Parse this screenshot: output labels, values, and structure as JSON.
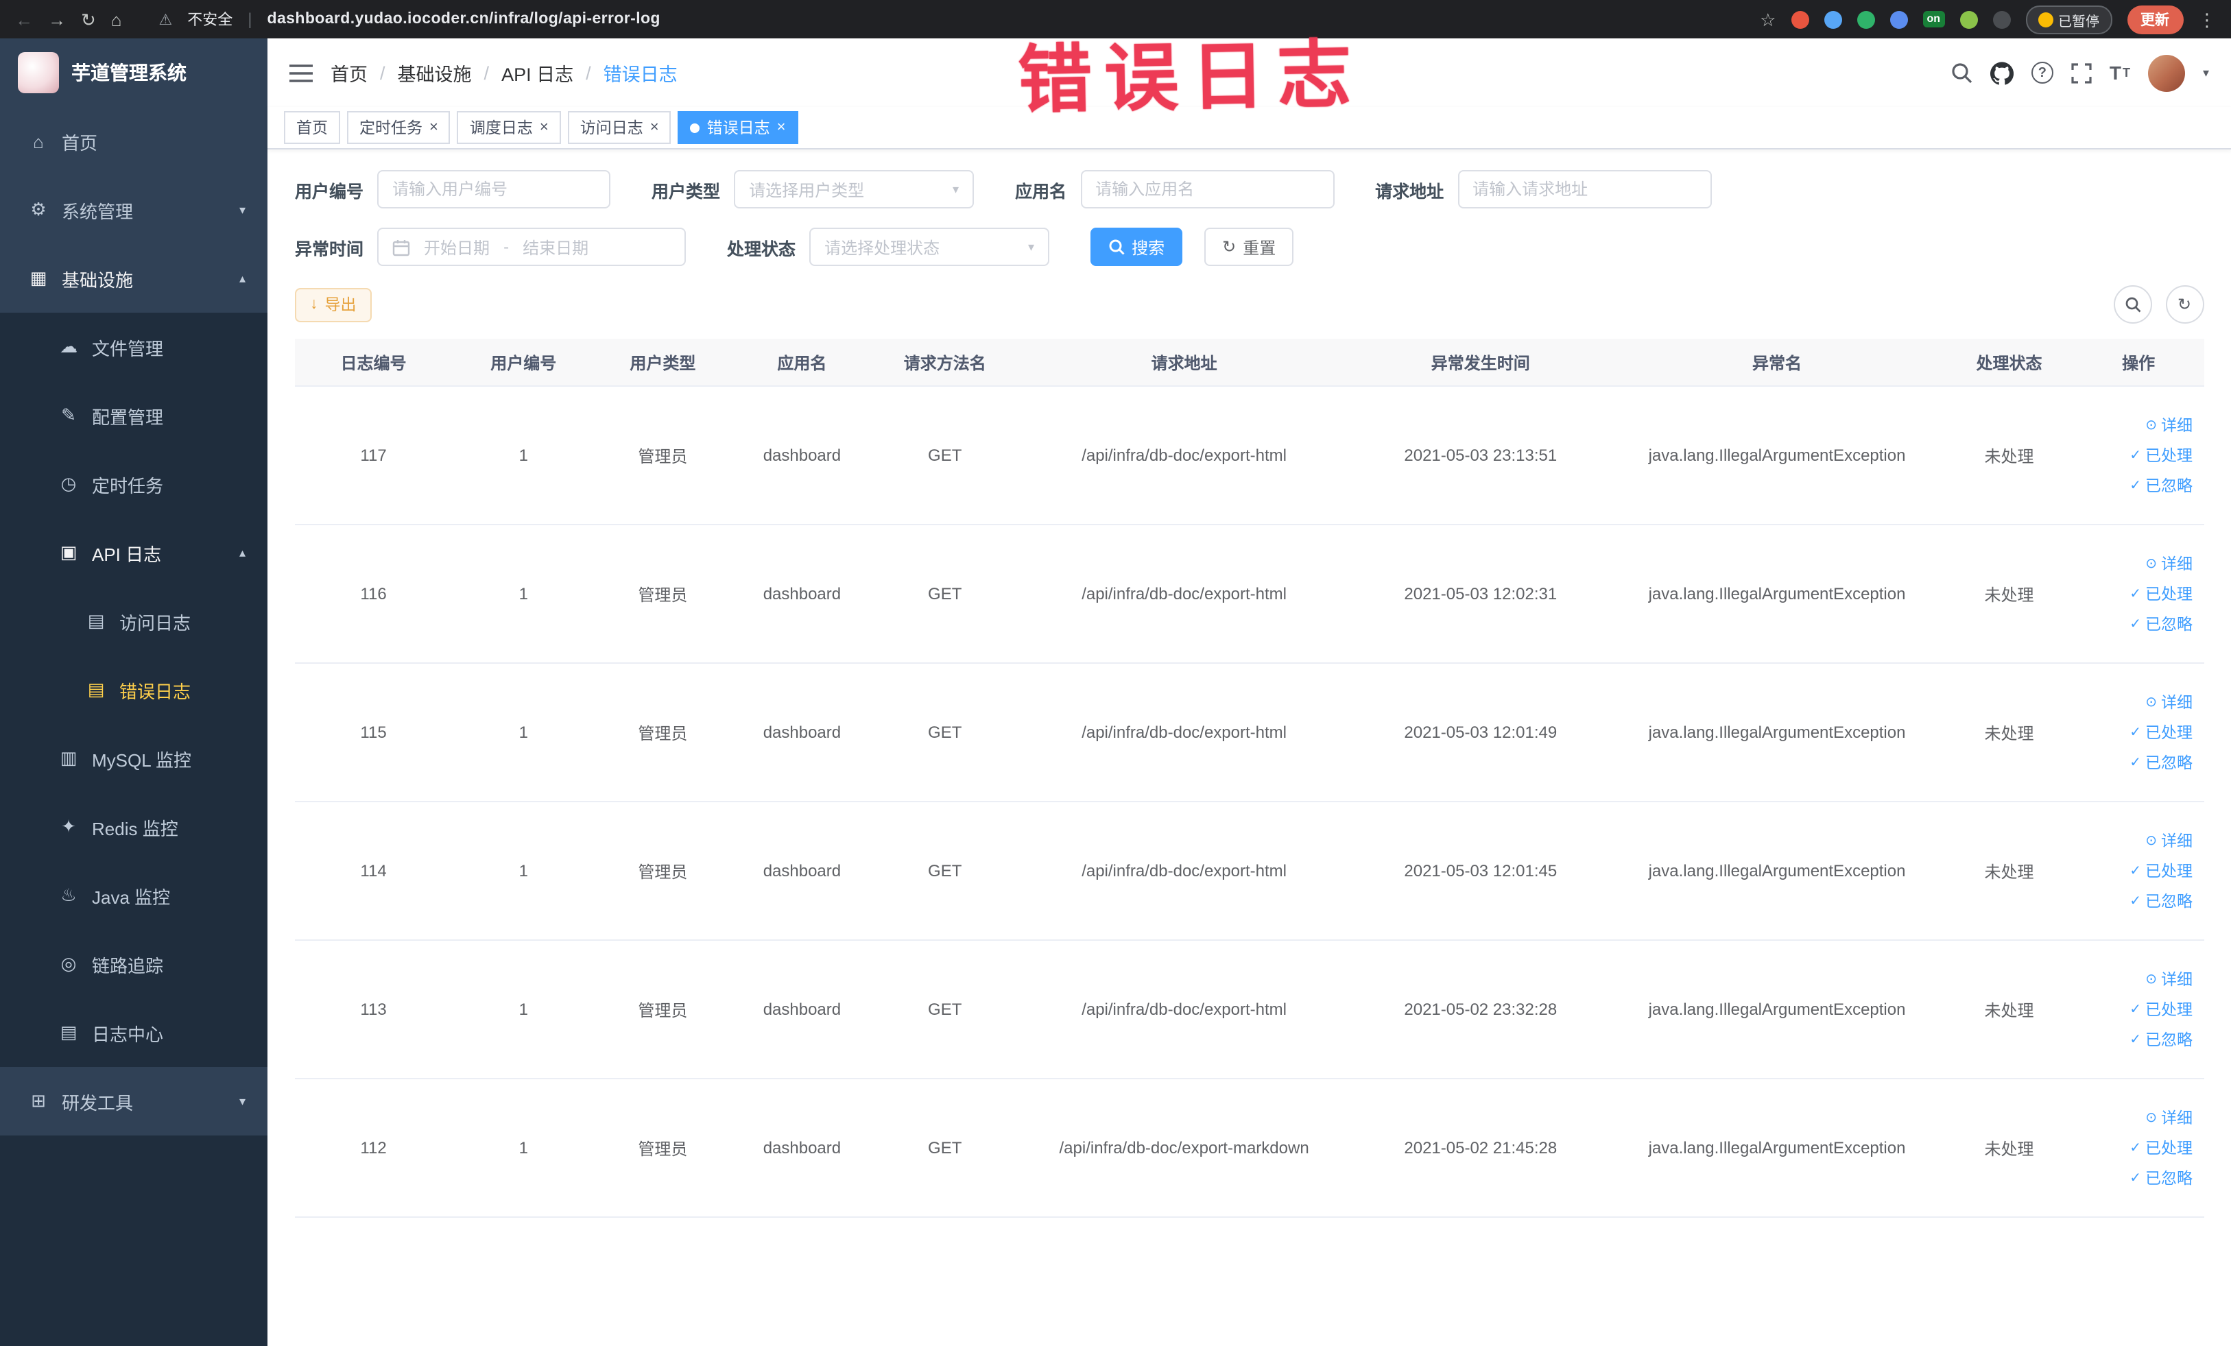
{
  "colors": {
    "accent": "#409eff",
    "sidebar_bg": "#304156",
    "sidebar_sub_bg": "#1f2d3d",
    "active_menu_text": "#ffd04b",
    "annotation_red": "#ed3b55",
    "export_warning": "#e6a23c"
  },
  "browser": {
    "security_text": "不安全",
    "url": "dashboard.yudao.iocoder.cn/infra/log/api-error-log",
    "on_badge": "on",
    "paused_badge": "已暂停",
    "update_button": "更新"
  },
  "annotation": {
    "text": "错误日志"
  },
  "sidebar": {
    "logo_title": "芋道管理系统",
    "items": [
      {
        "key": "home",
        "label": "首页",
        "icon": "home-icon",
        "level": 0
      },
      {
        "key": "system",
        "label": "系统管理",
        "icon": "gear-icon",
        "level": 0,
        "arrow": "down"
      },
      {
        "key": "infra",
        "label": "基础设施",
        "icon": "infra-icon",
        "level": 0,
        "arrow": "up",
        "trail": true
      },
      {
        "key": "file",
        "label": "文件管理",
        "icon": "file-icon",
        "level": 1
      },
      {
        "key": "config",
        "label": "配置管理",
        "icon": "config-icon",
        "level": 1
      },
      {
        "key": "job",
        "label": "定时任务",
        "icon": "cron-icon",
        "level": 1
      },
      {
        "key": "api-log",
        "label": "API 日志",
        "icon": "api-log-icon",
        "level": 1,
        "arrow": "up",
        "trail": true
      },
      {
        "key": "access-log",
        "label": "访问日志",
        "icon": "access-log-icon",
        "level": 2
      },
      {
        "key": "error-log",
        "label": "错误日志",
        "icon": "error-log-icon",
        "level": 2,
        "active": true
      },
      {
        "key": "mysql",
        "label": "MySQL 监控",
        "icon": "mysql-icon",
        "level": 1
      },
      {
        "key": "redis",
        "label": "Redis 监控",
        "icon": "redis-icon",
        "level": 1
      },
      {
        "key": "java",
        "label": "Java 监控",
        "icon": "java-icon",
        "level": 1
      },
      {
        "key": "trace",
        "label": "链路追踪",
        "icon": "trace-icon",
        "level": 1
      },
      {
        "key": "log-center",
        "label": "日志中心",
        "icon": "log-center-icon",
        "level": 1
      },
      {
        "key": "dev-tools",
        "label": "研发工具",
        "icon": "tools-icon",
        "level": 0,
        "arrow": "down"
      }
    ]
  },
  "breadcrumb": {
    "items": [
      "首页",
      "基础设施",
      "API 日志",
      "错误日志"
    ]
  },
  "tabs": [
    {
      "key": "home",
      "label": "首页",
      "closable": false,
      "active": false
    },
    {
      "key": "job",
      "label": "定时任务",
      "closable": true,
      "active": false
    },
    {
      "key": "job-log",
      "label": "调度日志",
      "closable": true,
      "active": false
    },
    {
      "key": "access-log",
      "label": "访问日志",
      "closable": true,
      "active": false
    },
    {
      "key": "error-log",
      "label": "错误日志",
      "closable": true,
      "active": true
    }
  ],
  "filters": {
    "user_id": {
      "label": "用户编号",
      "placeholder": "请输入用户编号"
    },
    "user_type": {
      "label": "用户类型",
      "placeholder": "请选择用户类型"
    },
    "app_name": {
      "label": "应用名",
      "placeholder": "请输入应用名"
    },
    "request_url": {
      "label": "请求地址",
      "placeholder": "请输入请求地址"
    },
    "exception_time": {
      "label": "异常时间",
      "start_placeholder": "开始日期",
      "separator": "-",
      "end_placeholder": "结束日期"
    },
    "process_status": {
      "label": "处理状态",
      "placeholder": "请选择处理状态"
    },
    "search_button": "搜索",
    "reset_button": "重置"
  },
  "toolbar": {
    "export_button": "导出"
  },
  "table": {
    "columns": [
      "日志编号",
      "用户编号",
      "用户类型",
      "应用名",
      "请求方法名",
      "请求地址",
      "异常发生时间",
      "异常名",
      "处理状态",
      "操作"
    ],
    "rows": [
      [
        "117",
        "1",
        "管理员",
        "dashboard",
        "GET",
        "/api/infra/db-doc/export-html",
        "2021-05-03 23:13:51",
        "java.lang.IllegalArgumentException",
        "未处理"
      ],
      [
        "116",
        "1",
        "管理员",
        "dashboard",
        "GET",
        "/api/infra/db-doc/export-html",
        "2021-05-03 12:02:31",
        "java.lang.IllegalArgumentException",
        "未处理"
      ],
      [
        "115",
        "1",
        "管理员",
        "dashboard",
        "GET",
        "/api/infra/db-doc/export-html",
        "2021-05-03 12:01:49",
        "java.lang.IllegalArgumentException",
        "未处理"
      ],
      [
        "114",
        "1",
        "管理员",
        "dashboard",
        "GET",
        "/api/infra/db-doc/export-html",
        "2021-05-03 12:01:45",
        "java.lang.IllegalArgumentException",
        "未处理"
      ],
      [
        "113",
        "1",
        "管理员",
        "dashboard",
        "GET",
        "/api/infra/db-doc/export-html",
        "2021-05-02 23:32:28",
        "java.lang.IllegalArgumentException",
        "未处理"
      ],
      [
        "112",
        "1",
        "管理员",
        "dashboard",
        "GET",
        "/api/infra/db-doc/export-markdown",
        "2021-05-02 21:45:28",
        "java.lang.IllegalArgumentException",
        "未处理"
      ]
    ],
    "row_actions": [
      "详细",
      "已处理",
      "已忽略"
    ]
  }
}
